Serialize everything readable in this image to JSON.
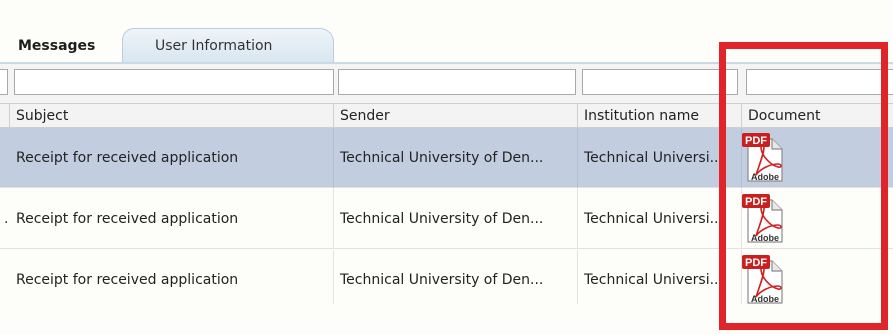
{
  "tabs": [
    {
      "label": "Messages",
      "active": true
    },
    {
      "label": "User Information",
      "active": false
    }
  ],
  "table": {
    "columns": [
      "Subject",
      "Sender",
      "Institution name",
      "Document"
    ],
    "rows": [
      {
        "subject": "Receipt for received application",
        "sender": "Technical University of Den...",
        "institution": "Technical Universi...",
        "document_icon": "pdf-adobe-icon",
        "selected": true
      },
      {
        "subject": "Receipt for received application",
        "sender": "Technical University of Den...",
        "institution": "Technical Universi...",
        "document_icon": "pdf-adobe-icon",
        "selected": false
      },
      {
        "subject": "Receipt for received application",
        "sender": "Technical University of Den...",
        "institution": "Technical Universi...",
        "document_icon": "pdf-adobe-icon",
        "selected": false
      }
    ]
  },
  "pdf_icon": {
    "badge": "PDF",
    "brand": "Adobe"
  },
  "colors": {
    "highlight_box": "#e0252a",
    "selected_row": "#c3cde0",
    "pdf_red": "#d01f1f"
  }
}
